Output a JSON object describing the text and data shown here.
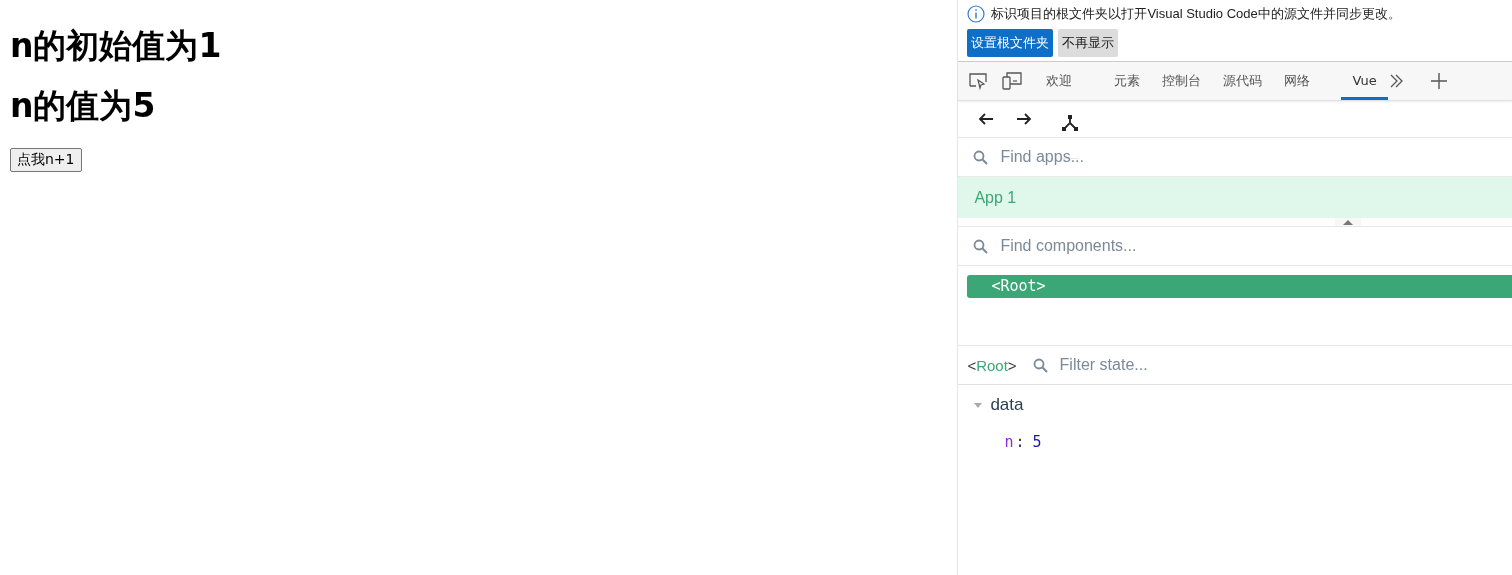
{
  "page": {
    "headings": [
      "n的初始值为1",
      "n的值为5"
    ],
    "button": "点我n+1"
  },
  "devtools": {
    "infobar": {
      "message": "标识项目的根文件夹以打开Visual Studio Code中的源文件并同步更改。",
      "buttons": [
        {
          "label": "设置根文件夹",
          "kind": "primary"
        },
        {
          "label": "不再显示",
          "kind": "secondary"
        }
      ]
    },
    "tabs": [
      {
        "label": "欢迎",
        "selected": false
      },
      {
        "label": "元素",
        "selected": false
      },
      {
        "label": "控制台",
        "selected": false
      },
      {
        "label": "源代码",
        "selected": false
      },
      {
        "label": "网络",
        "selected": false
      },
      {
        "label": "Vue",
        "selected": true
      }
    ],
    "apps_search": {
      "placeholder": "Find apps..."
    },
    "apps": [
      {
        "name": "App 1",
        "selected": true
      }
    ],
    "components_search": {
      "placeholder": "Find components..."
    },
    "components": [
      {
        "name": "<Root>",
        "selected": true
      }
    ],
    "inspector": {
      "component_open": "<",
      "component": "Root",
      "component_close": ">",
      "filter": {
        "placeholder": "Filter state..."
      },
      "sections": [
        {
          "name": "data",
          "expanded": true,
          "fields": [
            {
              "key": "n",
              "separator": ":",
              "value": "5"
            }
          ]
        }
      ]
    }
  }
}
